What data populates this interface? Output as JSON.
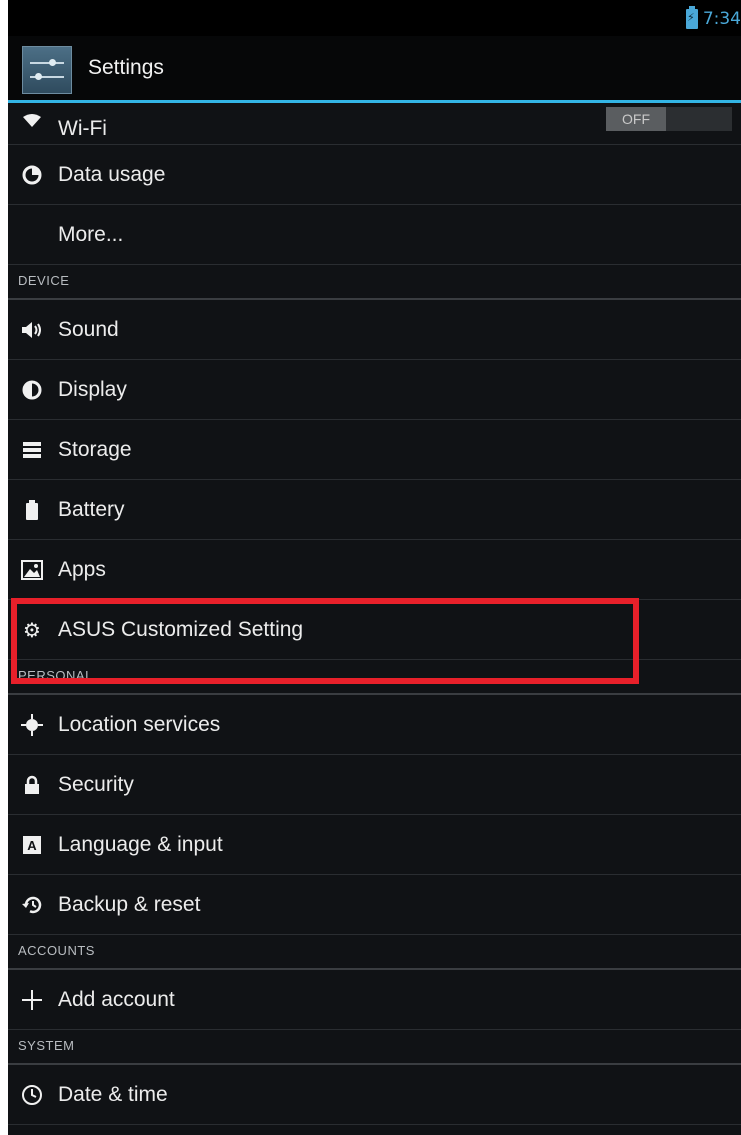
{
  "status_bar": {
    "time": "7:34"
  },
  "action_bar": {
    "title": "Settings"
  },
  "wifi": {
    "label": "Wi-Fi",
    "toggle_state": "OFF"
  },
  "wireless_items": [
    {
      "label": "Data usage",
      "icon": "data-usage-icon"
    },
    {
      "label": "More...",
      "icon": ""
    }
  ],
  "sections": {
    "device": "DEVICE",
    "personal": "PERSONAL",
    "accounts": "ACCOUNTS",
    "system": "SYSTEM"
  },
  "device_items": [
    {
      "label": "Sound",
      "icon": "sound-icon"
    },
    {
      "label": "Display",
      "icon": "display-icon"
    },
    {
      "label": "Storage",
      "icon": "storage-icon"
    },
    {
      "label": "Battery",
      "icon": "battery-icon"
    },
    {
      "label": "Apps",
      "icon": "apps-icon"
    },
    {
      "label": "ASUS Customized Setting",
      "icon": "gear-icon"
    }
  ],
  "personal_items": [
    {
      "label": "Location services",
      "icon": "location-icon"
    },
    {
      "label": "Security",
      "icon": "lock-icon"
    },
    {
      "label": "Language & input",
      "icon": "language-icon"
    },
    {
      "label": "Backup & reset",
      "icon": "backup-icon"
    }
  ],
  "accounts_items": [
    {
      "label": "Add account",
      "icon": "plus-icon"
    }
  ],
  "system_items": [
    {
      "label": "Date & time",
      "icon": "clock-icon"
    }
  ],
  "highlight_color": "#e8202a",
  "accent_color": "#33b5e5"
}
